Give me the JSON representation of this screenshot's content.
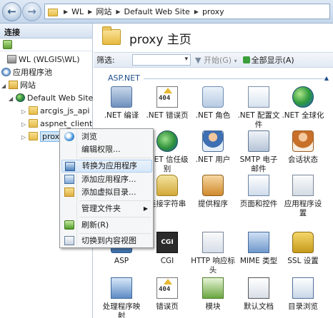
{
  "address_bar": {
    "crumbs": [
      "WL",
      "网站",
      "Default Web Site",
      "proxy"
    ]
  },
  "left_panel": {
    "header": "连接",
    "tree": {
      "server": "WL (WLGIS\\WL)",
      "app_pools": "应用程序池",
      "sites": "网站",
      "default_site": "Default Web Site",
      "children": [
        "arcgis_js_api",
        "aspnet_client",
        "proxy"
      ]
    }
  },
  "main": {
    "title": "proxy 主页",
    "filter": {
      "label": "筛选:",
      "go": "开始(G)",
      "show_all": "全部显示(A)"
    },
    "sections": {
      "aspnet": "ASP.NET"
    },
    "features_row1": [
      ".NET 编译",
      ".NET 错误页",
      ".NET 角色",
      ".NET 配置文件",
      ".NET 全球化"
    ],
    "features_row2": [
      ".NET 信任级别",
      ".NET 用户",
      "SMTP 电子邮件",
      "会话状态"
    ],
    "features_row3": [
      "连接字符串",
      "提供程序",
      "页面和控件",
      "应用程序设置"
    ],
    "features_row4": [
      "ASP",
      "CGI",
      "HTTP 响应标头",
      "MIME 类型",
      "SSL 设置"
    ],
    "features_row5": [
      "处理程序映射",
      "错误页",
      "模块",
      "默认文档",
      "目录浏览"
    ],
    "cgi_text": "CGI"
  },
  "context_menu": {
    "items": [
      "浏览",
      "编辑权限...",
      "转换为应用程序",
      "添加应用程序...",
      "添加虚拟目录...",
      "管理文件夹",
      "刷新(R)",
      "切换到内容视图"
    ],
    "highlighted_index": 2
  },
  "icons": {
    "back": "back-arrow-icon",
    "forward": "forward-arrow-icon"
  }
}
